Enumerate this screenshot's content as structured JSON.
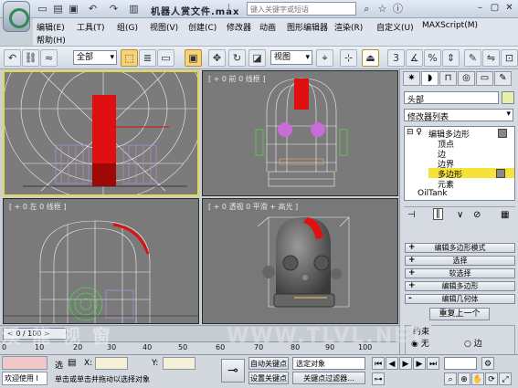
{
  "window": {
    "title": "机器人赏文件.max",
    "search_placeholder": "键入关键字或短语"
  },
  "menu": {
    "items": [
      "编辑(E)",
      "工具(T)",
      "组(G)",
      "视图(V)",
      "创建(C)",
      "修改器",
      "动画",
      "图形编辑器",
      "渲染(R)",
      "自定义(U)",
      "MAXScript(M)",
      "帮助(H)"
    ]
  },
  "toolbar": {
    "selection_filter": "全部",
    "reference_coord": "视图"
  },
  "viewports": {
    "top_left": {
      "label": ""
    },
    "top_right": {
      "label": "[ + 0 前 0 线框 ]"
    },
    "bottom_left": {
      "label": "[ + 0 左 0 线框 ]"
    },
    "bottom_right": {
      "label": "[ + 0 透视 0 平滑 + 高光 ]"
    }
  },
  "command_panel": {
    "object_name": "头部",
    "modifier_list": "修改器列表",
    "stack": [
      {
        "label": "编辑多边形",
        "level": 0,
        "selected": false
      },
      {
        "label": "顶点",
        "level": 1,
        "selected": false
      },
      {
        "label": "边",
        "level": 1,
        "selected": false
      },
      {
        "label": "边界",
        "level": 1,
        "selected": false
      },
      {
        "label": "多边形",
        "level": 1,
        "selected": true
      },
      {
        "label": "元素",
        "level": 1,
        "selected": false
      },
      {
        "label": "OilTank",
        "level": 0,
        "selected": false
      }
    ],
    "rollouts": [
      {
        "sign": "+",
        "label": "编辑多边形模式"
      },
      {
        "sign": "+",
        "label": "选择"
      },
      {
        "sign": "+",
        "label": "软选择"
      },
      {
        "sign": "+",
        "label": "编辑多边形"
      },
      {
        "sign": "-",
        "label": "编辑几何体"
      }
    ],
    "repeat_last": "重复上一个",
    "constraints_label": "约束",
    "constraint_none": "无",
    "constraint_edge": "边"
  },
  "timeline": {
    "frame_counter": "0 / 100",
    "ticks": [
      "0",
      "10",
      "20",
      "30",
      "40",
      "50",
      "60",
      "70",
      "80",
      "90",
      "100"
    ]
  },
  "status": {
    "welcome": "欢迎使用 I",
    "prompt": "单击或单击并拖动以选择对象",
    "lock_label": "选",
    "x_label": "X:",
    "y_label": "Y:",
    "auto_key": "自动关键点",
    "set_key": "设置关键点",
    "key_mode": "选定对象",
    "key_filters": "关键点过滤器..."
  },
  "watermarks": [
    "溪 龍 视 窗",
    "WWW.TLVL.NET"
  ],
  "colors": {
    "accent": "#f6d27a",
    "selected_stack": "#f5e23a",
    "viewport_bg": "#787878",
    "red": "#e01010"
  }
}
